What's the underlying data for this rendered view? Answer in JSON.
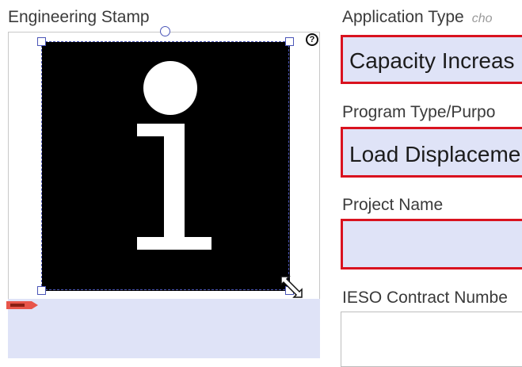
{
  "stamp": {
    "label": "Engineering Stamp",
    "help_icon": "?"
  },
  "application_type": {
    "label": "Application Type",
    "hint": "cho",
    "value": "Capacity Increas"
  },
  "program_type": {
    "label": "Program Type/Purpo",
    "value": "Load Displaceme"
  },
  "project_name": {
    "label": "Project Name",
    "value": ""
  },
  "ieso_contract": {
    "label": "IESO Contract Numbe",
    "value": ""
  },
  "icons": {
    "info": "info-icon",
    "help": "question-circle-icon",
    "resize": "resize-cursor-icon",
    "tag": "tag-marker-icon"
  },
  "colors": {
    "required_border": "#d9121f",
    "field_fill": "#dfe3f7",
    "selection": "#4b56b8",
    "tag": "#e8554a"
  }
}
